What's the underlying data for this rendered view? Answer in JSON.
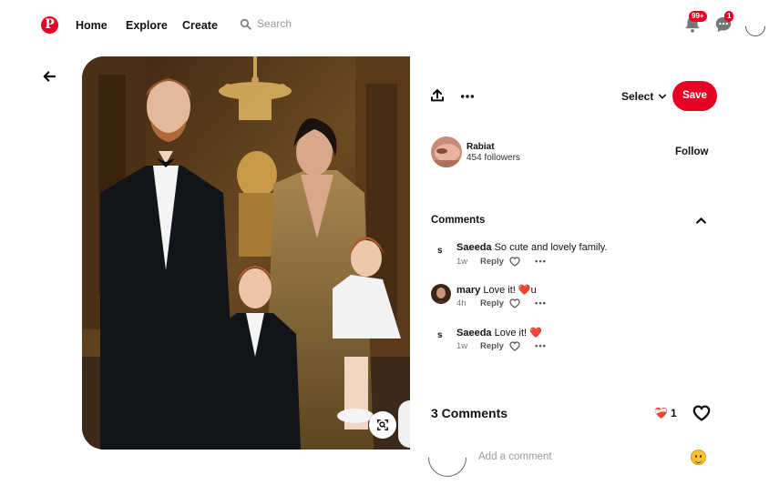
{
  "header": {
    "logo_letter": "P",
    "nav": {
      "home": "Home",
      "explore": "Explore",
      "create": "Create"
    },
    "search_placeholder": "Search",
    "notifications_badge": "99+",
    "messages_badge": "1",
    "brand_color": "#e60023"
  },
  "pin": {
    "image_alt": "Family portrait of a man, woman and two children in formal attire"
  },
  "actions": {
    "select_label": "Select",
    "save_label": "Save"
  },
  "creator": {
    "name": "Rabiat",
    "followers": "454 followers",
    "follow_label": "Follow"
  },
  "comments_section": {
    "title": "Comments",
    "items": [
      {
        "initial": "s",
        "author": "Saeeda",
        "text": "So cute and lovely family.",
        "emoji": "",
        "time": "1w",
        "reply": "Reply",
        "more": "•••"
      },
      {
        "initial": "",
        "author": "mary",
        "text": "Love it! ",
        "emoji": "❤️u",
        "time": "4h",
        "reply": "Reply",
        "more": "•••"
      },
      {
        "initial": "s",
        "author": "Saeeda",
        "text": "Love it! ",
        "emoji": "❤️",
        "time": "1w",
        "reply": "Reply",
        "more": "•••"
      }
    ],
    "count_label": "3 Comments",
    "reaction_emoji": "❤️‍🩹",
    "reaction_count": "1",
    "add_placeholder": "Add a comment"
  }
}
